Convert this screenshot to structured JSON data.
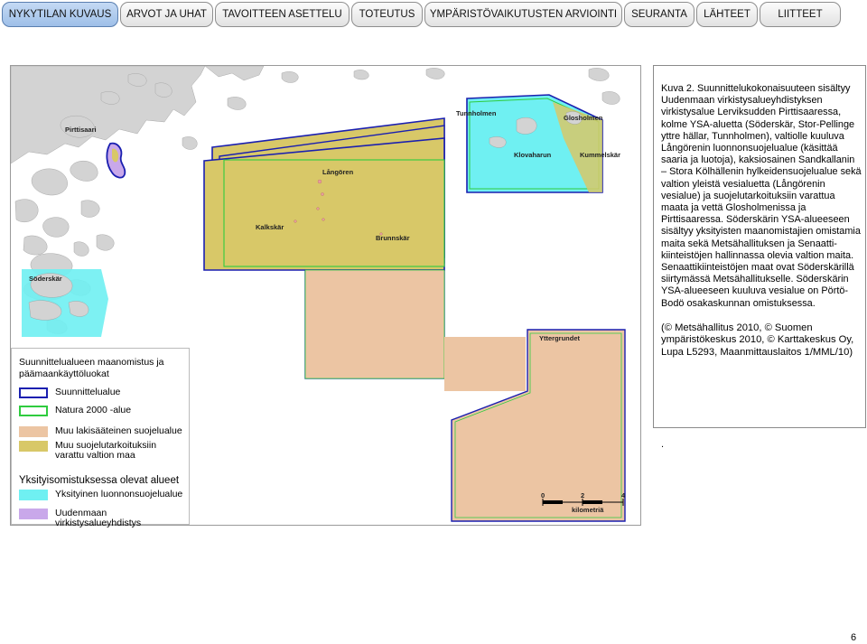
{
  "nav": {
    "tabs": [
      {
        "label": "NYKYTILAN KUVAUS",
        "active": true
      },
      {
        "label": "ARVOT JA UHAT",
        "active": false
      },
      {
        "label": "TAVOITTEEN ASETTELU",
        "active": false
      },
      {
        "label": "TOTEUTUS",
        "active": false
      },
      {
        "label": "YMPÄRISTÖVAIKUTUSTEN ARVIOINTI",
        "active": false
      },
      {
        "label": "SEURANTA",
        "active": false
      },
      {
        "label": "LÄHTEET",
        "active": false
      },
      {
        "label": "LIITTEET",
        "active": false
      }
    ]
  },
  "map": {
    "place_labels": {
      "pirttisaari": "Pirttisaari",
      "tunnholmen": "Tunnholmen",
      "glosholmen": "Glosholmen",
      "klovaharun": "Klovaharun",
      "kummelskar": "Kummelskär",
      "langoren": "Långören",
      "kalkskar": "Kalkskär",
      "brunnskar": "Brunnskär",
      "soderskar": "Söderskär",
      "yttergrundet": "Yttergrundet"
    },
    "scale_bar": {
      "ticks": [
        "0",
        "2",
        "4"
      ],
      "unit": "kilometriä"
    },
    "colors": {
      "sea": "#ffffff",
      "land": "#d3d3d3",
      "planning_area_border": "#1a1fb0",
      "natura_border": "#2fcc3f",
      "statutory_reserve": "#ecc5a3",
      "other_reserve": "#d8c868",
      "private_reserve": "#6ff0f2",
      "uusimaa_association": "#c9a8ea"
    }
  },
  "legend": {
    "title": "Suunnittelualueen maanomistus ja päämaankäyttöluokat",
    "items": [
      {
        "label": "Suunnittelualue",
        "swatch": "outline-blue"
      },
      {
        "label": "Natura 2000 -alue",
        "swatch": "outline-green"
      },
      {
        "label": "Muu lakisääteinen suojelualue",
        "swatch": "fill-salmon"
      },
      {
        "label": "Muu suojelutarkoituksiin varattu valtion maa",
        "swatch": "fill-olive"
      }
    ],
    "private_title": "Yksityisomistuksessa olevat alueet",
    "private_items": [
      {
        "label": "Yksityinen luonnonsuojelualue",
        "swatch": "fill-cyan"
      },
      {
        "label": "Uudenmaan virkistysalueyhdistys",
        "swatch": "fill-purple"
      }
    ]
  },
  "caption": {
    "text": "Kuva 2. Suunnittelukokonaisuuteen sisältyy Uudenmaan virkistysalueyhdistyksen virkistysalue Lerviksudden Pirttisaaressa, kolme YSA-aluetta (Söderskär, Stor-Pellinge yttre hällar, Tunnholmen), valtiolle kuuluva Långörenin luonnonsuojelualue (käsittää saaria ja luotoja), kaksiosainen Sandkallanin – Stora Kölhällenin hylkeidensuojelualue sekä valtion yleistä vesialuetta (Långörenin vesialue) ja suojelutarkoituksiin varattua maata ja vettä Glosholmenissa ja Pirttisaaressa. Söderskärin YSA-alueeseen sisältyy yksityisten maanomistajien omistamia maita sekä Metsähallituksen ja Senaatti-kiinteistöjen hallinnassa olevia valtion maita. Senaattikiinteistöjen maat ovat Söderskärillä siirtymässä Metsähallitukselle. Söderskärin YSA-alueeseen kuuluva vesialue on Pörtö-Bodö osakaskunnan omistuksessa.",
    "credit": "(© Metsähallitus 2010, © Suomen ympäristökeskus 2010, © Karttakeskus Oy, Lupa L5293, Maanmittauslaitos 1/MML/10)"
  },
  "footer": {
    "dot": ".",
    "page_number": "6"
  }
}
